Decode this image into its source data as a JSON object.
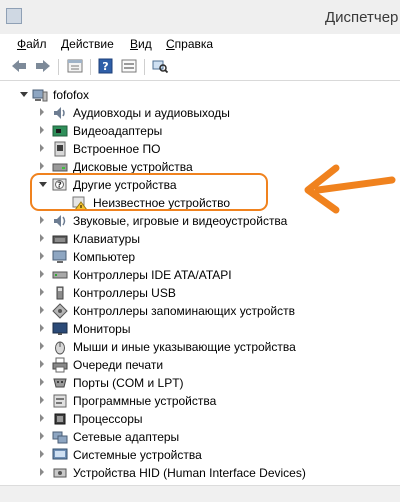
{
  "window": {
    "title": "Диспетчер"
  },
  "menu": {
    "items": [
      {
        "first": "Ф",
        "rest": "айл"
      },
      {
        "first": "Д",
        "rest": "ействие"
      },
      {
        "first": "В",
        "rest": "ид"
      },
      {
        "first": "С",
        "rest": "правка"
      }
    ]
  },
  "toolbar": {
    "icons": [
      "back-arrow-icon",
      "forward-arrow-icon",
      "properties-icon",
      "help-icon",
      "view-icon",
      "scan-hardware-icon"
    ]
  },
  "tree": {
    "root": "fofofox",
    "items": [
      "Аудиовходы и аудиовыходы",
      "Видеоадаптеры",
      "Встроенное ПО",
      "Дисковые устройства",
      "Другие устройства",
      "Неизвестное устройство",
      "Звуковые, игровые и видеоустройства",
      "Клавиатуры",
      "Компьютер",
      "Контроллеры IDE ATA/ATAPI",
      "Контроллеры USB",
      "Контроллеры запоминающих устройств",
      "Мониторы",
      "Мыши и иные указывающие устройства",
      "Очереди печати",
      "Порты (COM и LPT)",
      "Программные устройства",
      "Процессоры",
      "Сетевые адаптеры",
      "Системные устройства",
      "Устройства HID (Human Interface Devices)"
    ]
  },
  "annotation": {
    "highlight_color": "#f0821e"
  }
}
